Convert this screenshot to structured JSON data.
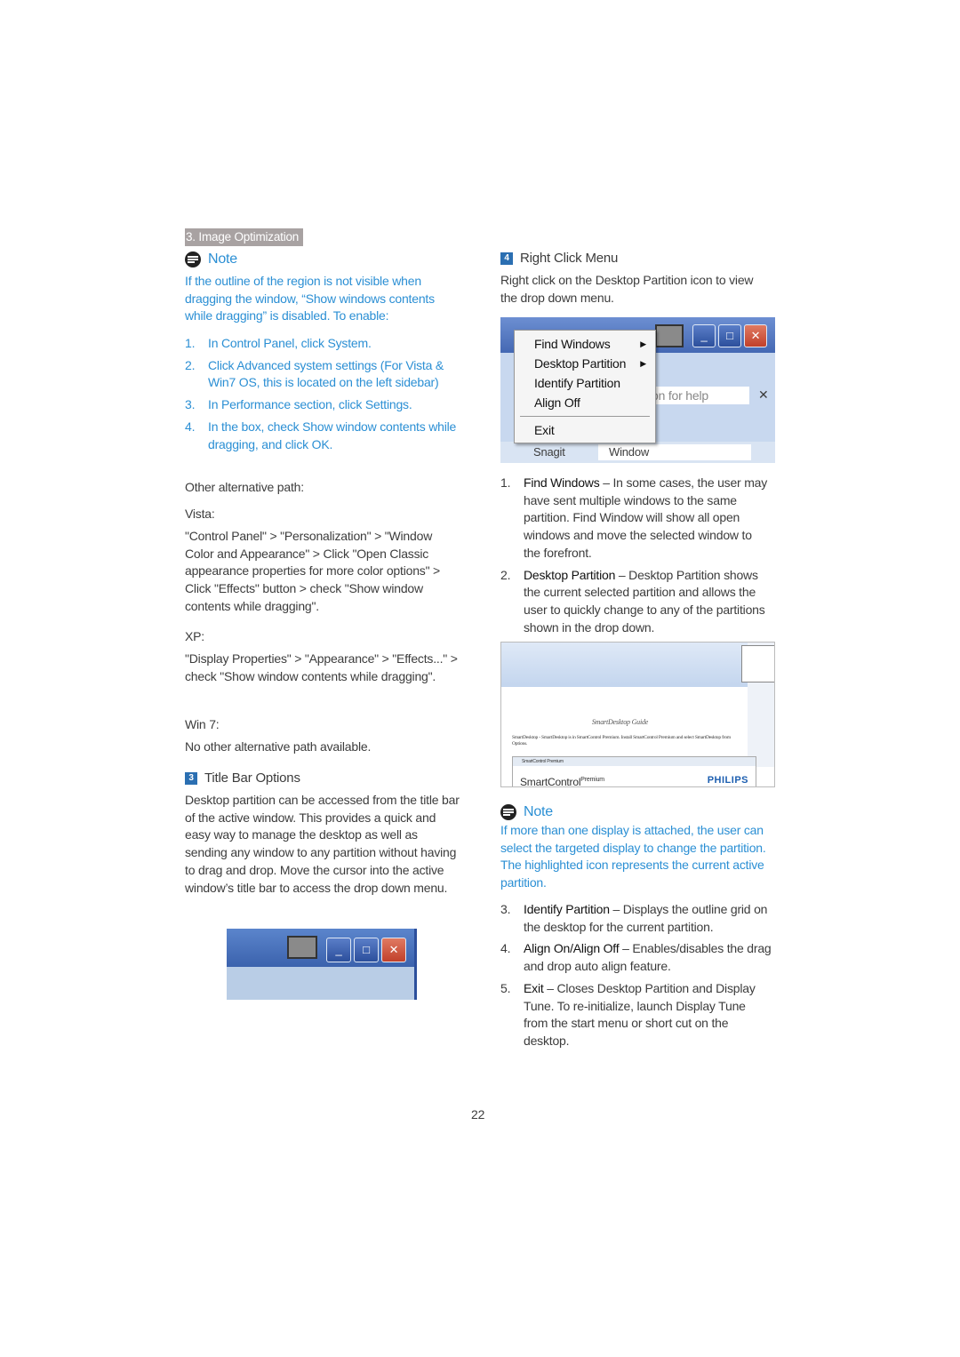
{
  "section_badge": "3. Image Optimization",
  "left": {
    "note": {
      "title": "Note",
      "text": "If the outline of the region is not visible when dragging the window, “Show windows contents while dragging” is disabled. To enable:",
      "steps": [
        {
          "n": "1.",
          "text": "In Control Panel, click System."
        },
        {
          "n": "2.",
          "text": "Click Advanced system settings (For Vista & Win7 OS, this is located on the left sidebar)"
        },
        {
          "n": "3.",
          "text": "In Performance section, click Settings."
        },
        {
          "n": "4.",
          "text": "In the box, check Show window contents while dragging, and click OK."
        }
      ]
    },
    "other_path": "Other alternative path:",
    "vista_label": "Vista:",
    "vista_text": "\"Control Panel\" > \"Personalization\" > \"Window Color and Appearance\" > Click \"Open Classic appearance properties for more color options\" > Click \"Effects\" button > check \"Show window contents while dragging\".",
    "xp_label": "XP:",
    "xp_text": "\"Display Properties\" > \"Appearance\" > \"Effects...\" > check \"Show window contents while dragging\".",
    "win7_label": "Win 7:",
    "win7_text": "No other alternative path available.",
    "title_bar": {
      "num": "3",
      "title": "Title Bar Options",
      "text": "Desktop partition can be accessed from the title bar of the active window. This provides a quick and easy way to manage the desktop as well as sending any window to any partition without having to drag and drop. Move the cursor into the active window’s title bar to access the drop down menu."
    }
  },
  "right": {
    "rcm": {
      "num": "4",
      "title": "Right Click Menu",
      "text": "Right click on the Desktop Partition icon to view the drop down menu."
    },
    "screenshot1": {
      "menu": [
        "Find Windows",
        "Desktop Partition",
        "Identify Partition",
        "Align Off",
        "Exit"
      ],
      "help_text": "on for help",
      "snagit": "Snagit",
      "window": "Window"
    },
    "items_a": [
      {
        "n": "1.",
        "term": "Find Windows",
        "text": " – In some cases, the user may have sent multiple windows to the same partition. Find Window will show all open windows and move the selected window to the forefront."
      },
      {
        "n": "2.",
        "term": "Desktop Partition",
        "text": " – Desktop Partition shows the current selected partition and allows the user to quickly change to any of the partitions shown in the drop down."
      }
    ],
    "screenshot2": {
      "doc_title": "SmartDesktop Guide",
      "doc_text": "SmartDesktop - SmartDesktop is in SmartControl Premium. Install SmartControl Premium and select SmartDesktop from Options.",
      "panel_title": "SmartControl Premium",
      "brand": "SmartControl",
      "brand_sup": "Premium",
      "logo": "PHILIPS"
    },
    "note": {
      "title": "Note",
      "text": "If more than one display is attached, the user can select the targeted display to change the partition. The highlighted icon represents the current active partition."
    },
    "items_b": [
      {
        "n": "3.",
        "term": "Identify Partition",
        "text": " – Displays the outline grid on the desktop for the current partition."
      },
      {
        "n": "4.",
        "term": "Align On/Align Off",
        "text": " – Enables/disables the drag and drop auto align feature."
      },
      {
        "n": "5.",
        "term": "Exit",
        "text": " – Closes Desktop Partition and Display Tune. To re-initialize, launch Display Tune from the start menu or short cut on the desktop."
      }
    ]
  },
  "page_number": "22",
  "colors": {
    "accent": "#2b8fd4",
    "badge": "#a8a2a2",
    "text": "#3c3c3c"
  }
}
